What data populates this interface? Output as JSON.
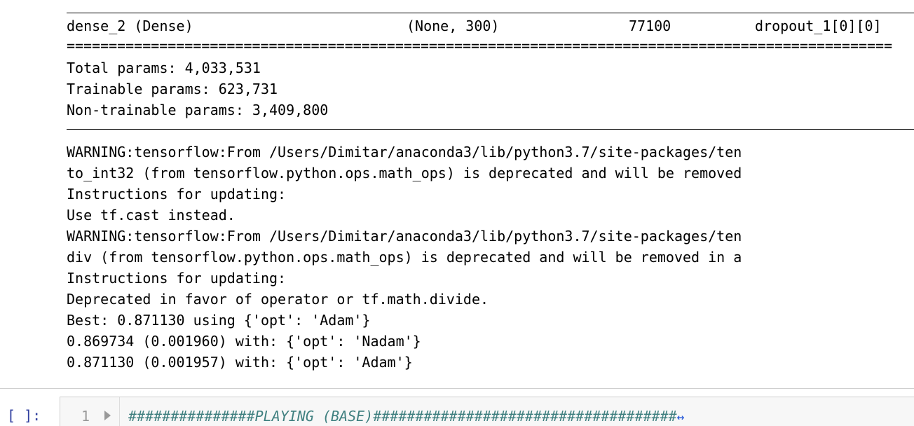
{
  "output": {
    "layer_row": {
      "name": "dense_2 (Dense)",
      "shape": "(None, 300)",
      "params": "77100",
      "connected": "dropout_1[0][0]"
    },
    "separator_double": "==================================================================================================",
    "summary": {
      "total": "Total params: 4,033,531",
      "trainable": "Trainable params: 623,731",
      "non_trainable": "Non-trainable params: 3,409,800"
    },
    "log_lines": [
      "WARNING:tensorflow:From /Users/Dimitar/anaconda3/lib/python3.7/site-packages/ten",
      "to_int32 (from tensorflow.python.ops.math_ops) is deprecated and will be removed",
      "Instructions for updating:",
      "Use tf.cast instead.",
      "WARNING:tensorflow:From /Users/Dimitar/anaconda3/lib/python3.7/site-packages/ten",
      "div (from tensorflow.python.ops.math_ops) is deprecated and will be removed in a",
      "Instructions for updating:",
      "Deprecated in favor of operator or tf.math.divide.",
      "Best: 0.871130 using {'opt': 'Adam'}",
      "0.869734 (0.001960) with: {'opt': 'Nadam'}",
      "0.871130 (0.001957) with: {'opt': 'Adam'}"
    ]
  },
  "next_cell": {
    "prompt": "[ ]:",
    "line_number": "1",
    "code": "###############PLAYING (BASE)####################################",
    "collapse_marker": "↔"
  },
  "colors": {
    "prompt": "#303f9f",
    "comment": "#408080",
    "editor_bg": "#f7f7f7"
  }
}
